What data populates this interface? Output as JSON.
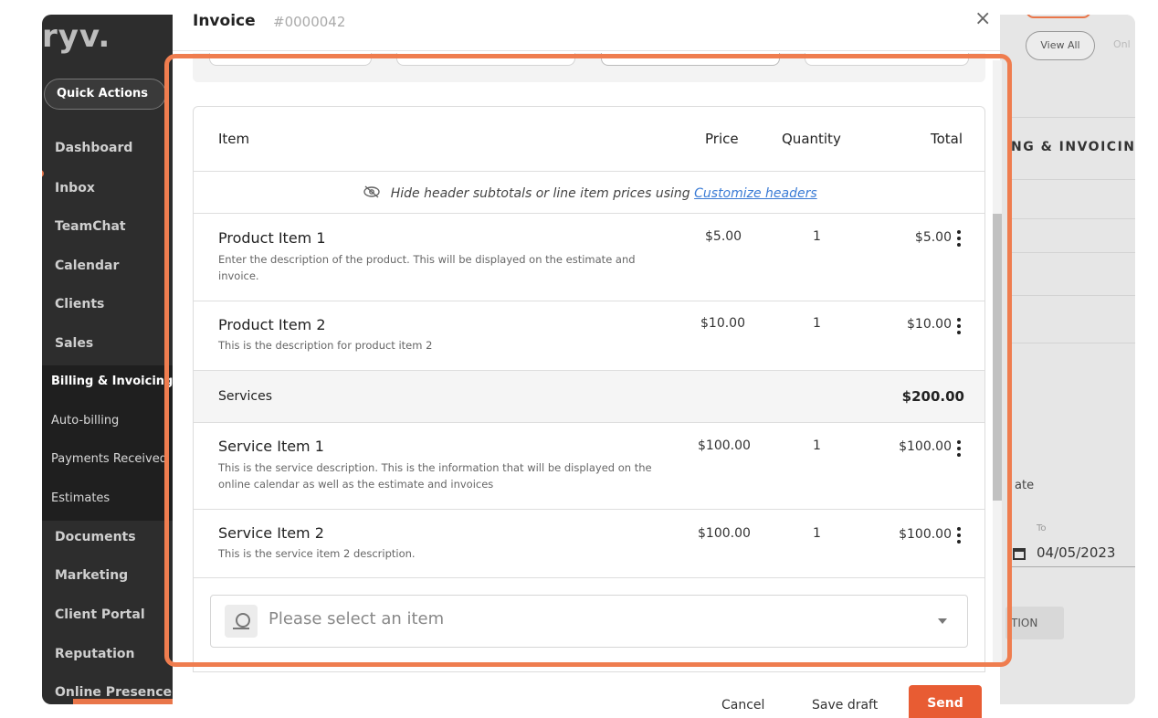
{
  "app": {
    "logo": "ryv."
  },
  "sidebar": {
    "quick_actions": "Quick Actions",
    "items": [
      "Dashboard",
      "Inbox",
      "TeamChat",
      "Calendar",
      "Clients",
      "Sales"
    ],
    "billing_sub": [
      "Billing & Invoicing",
      "Auto-billing",
      "Payments Received",
      "Estimates"
    ],
    "items_lower": [
      "Documents",
      "Marketing",
      "Client Portal",
      "Reputation",
      "Online Presence"
    ]
  },
  "background_page": {
    "view_all": "View All",
    "online": "Onl",
    "section_heading": "NG & INVOICIN",
    "date_label": "ate",
    "to_label": "To",
    "to_date": "04/05/2023",
    "action_button": "TION"
  },
  "modal": {
    "title": "Invoice",
    "number": "#0000042",
    "table": {
      "headers": {
        "item": "Item",
        "price": "Price",
        "quantity": "Quantity",
        "total": "Total"
      },
      "hint_text": "Hide header subtotals or line item prices using",
      "hint_link": "Customize headers",
      "rows": [
        {
          "name": "Product Item 1",
          "description": "Enter the description of the product. This will be displayed on the estimate and invoice.",
          "price": "$5.00",
          "quantity": "1",
          "total": "$5.00"
        },
        {
          "name": "Product Item 2",
          "description": "This is the description for product item 2",
          "price": "$10.00",
          "quantity": "1",
          "total": "$10.00"
        }
      ],
      "section": {
        "label": "Services",
        "total": "$200.00"
      },
      "service_rows": [
        {
          "name": "Service Item 1",
          "description": "This is the service description. This is the information that will be displayed on the online calendar as well as the estimate and invoices",
          "price": "$100.00",
          "quantity": "1",
          "total": "$100.00"
        },
        {
          "name": "Service Item 2",
          "description": "This is the service item 2 description.",
          "price": "$100.00",
          "quantity": "1",
          "total": "$100.00"
        }
      ],
      "select_placeholder": "Please select an item"
    },
    "footer": {
      "cancel": "Cancel",
      "save_draft": "Save draft",
      "send": "Send"
    }
  },
  "colors": {
    "accent": "#e85c33",
    "highlight": "#ef7d4f",
    "sidebar_bg": "#2d2d2d",
    "link": "#3a7bd5"
  }
}
